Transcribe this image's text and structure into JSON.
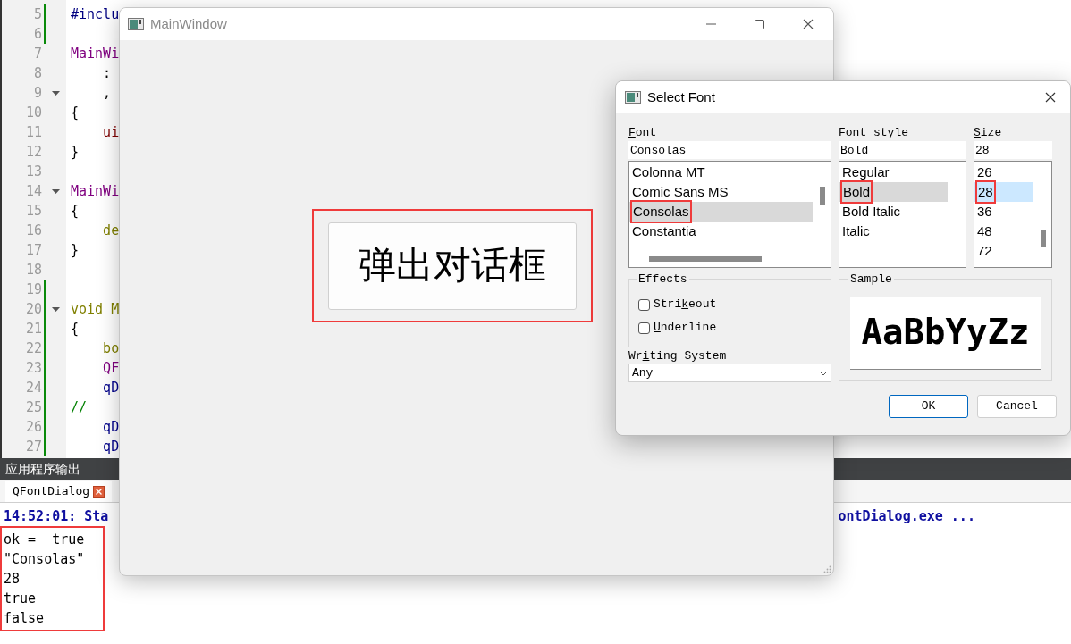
{
  "editor": {
    "lines": [
      {
        "number": "5",
        "text": "#inclu",
        "kind": "preprocessor",
        "changed": true,
        "fold": false
      },
      {
        "number": "6",
        "changed": true,
        "fold": false
      },
      {
        "number": "7",
        "text": "MainWi",
        "kind": "type",
        "changed": false,
        "fold": false
      },
      {
        "number": "8",
        "text": "    :",
        "kind": "plain",
        "changed": false,
        "fold": false
      },
      {
        "number": "9",
        "text": "    ,",
        "kind": "plain",
        "changed": false,
        "fold": true
      },
      {
        "number": "10",
        "text": "{",
        "kind": "plain",
        "changed": false,
        "fold": false
      },
      {
        "number": "11",
        "text": "    ui",
        "kind": "member",
        "changed": false,
        "fold": false
      },
      {
        "number": "12",
        "text": "}",
        "kind": "plain",
        "changed": false,
        "fold": false
      },
      {
        "number": "13",
        "changed": false,
        "fold": false
      },
      {
        "number": "14",
        "text": "MainWi",
        "kind": "type",
        "changed": false,
        "fold": true
      },
      {
        "number": "15",
        "text": "{",
        "kind": "plain",
        "changed": false,
        "fold": false
      },
      {
        "number": "16",
        "text": "    de",
        "kind": "keyword",
        "changed": false,
        "fold": false
      },
      {
        "number": "17",
        "text": "}",
        "kind": "plain",
        "changed": false,
        "fold": false
      },
      {
        "number": "18",
        "changed": false,
        "fold": false
      },
      {
        "number": "19",
        "changed": true,
        "fold": false
      },
      {
        "number": "20",
        "text": "void M",
        "kind": "keyword",
        "changed": true,
        "fold": true
      },
      {
        "number": "21",
        "text": "{",
        "kind": "plain",
        "changed": true,
        "fold": false
      },
      {
        "number": "22",
        "text": "    bo",
        "kind": "keyword",
        "changed": true,
        "fold": false
      },
      {
        "number": "23",
        "text": "    QF",
        "kind": "type",
        "changed": true,
        "fold": false
      },
      {
        "number": "24",
        "text": "    qD",
        "kind": "call",
        "changed": true,
        "fold": false
      },
      {
        "number": "25",
        "text": "//",
        "kind": "comment",
        "changed": true,
        "fold": false
      },
      {
        "number": "26",
        "text": "    qD",
        "kind": "call",
        "changed": true,
        "fold": false
      },
      {
        "number": "27",
        "text": "    qD",
        "kind": "call",
        "changed": true,
        "fold": false
      }
    ]
  },
  "output": {
    "title": "应用程序输出",
    "tab": "QFontDialog",
    "status_left": "14:52:01: Sta",
    "status_right": "ontDialog.exe ...",
    "annotated": true,
    "lines": [
      "ok =  true",
      "\"Consolas\"",
      "28",
      "true",
      "false"
    ]
  },
  "main_window": {
    "title": "MainWindow",
    "button": {
      "label": "弹出对话框",
      "annotated": true
    }
  },
  "font_dialog": {
    "title": "Select Font",
    "font": {
      "label": {
        "key": "F",
        "post": "ont"
      },
      "value": "Consolas",
      "items": [
        {
          "text": "Colonna MT",
          "selected": false,
          "annotated": false
        },
        {
          "text": "Comic Sans MS",
          "selected": false,
          "annotated": false
        },
        {
          "text": "Consolas",
          "selected": true,
          "annotated": true
        },
        {
          "text": "Constantia",
          "selected": false,
          "annotated": false
        }
      ]
    },
    "style": {
      "label": {
        "pre": "Font style"
      },
      "value": "Bold",
      "items": [
        {
          "text": "Regular",
          "selected": false,
          "annotated": false
        },
        {
          "text": "Bold",
          "selected": true,
          "annotated": true
        },
        {
          "text": "Bold Italic",
          "selected": false,
          "annotated": false
        },
        {
          "text": "Italic",
          "selected": false,
          "annotated": false
        }
      ]
    },
    "size": {
      "label": {
        "key": "S",
        "post": "ize"
      },
      "value": "28",
      "items": [
        {
          "text": "26",
          "selected": false,
          "annotated": false
        },
        {
          "text": "28",
          "selected": true,
          "annotated": true
        },
        {
          "text": "36",
          "selected": false,
          "annotated": false
        },
        {
          "text": "48",
          "selected": false,
          "annotated": false
        },
        {
          "text": "72",
          "selected": false,
          "annotated": false
        }
      ]
    },
    "effects": {
      "title": "Effects",
      "options": [
        {
          "label": {
            "pre": "Stri",
            "key": "k",
            "post": "eout"
          },
          "checked": false
        },
        {
          "label": {
            "key": "U",
            "post": "nderline"
          },
          "checked": false
        }
      ]
    },
    "writing_system": {
      "label": {
        "pre": "Wr",
        "key": "i",
        "post": "ting System"
      },
      "value": "Any"
    },
    "sample": {
      "title": "Sample",
      "text": "AaBbYyZz"
    },
    "buttons": [
      {
        "label": "OK",
        "default": true
      },
      {
        "label": "Cancel",
        "default": false
      }
    ]
  }
}
